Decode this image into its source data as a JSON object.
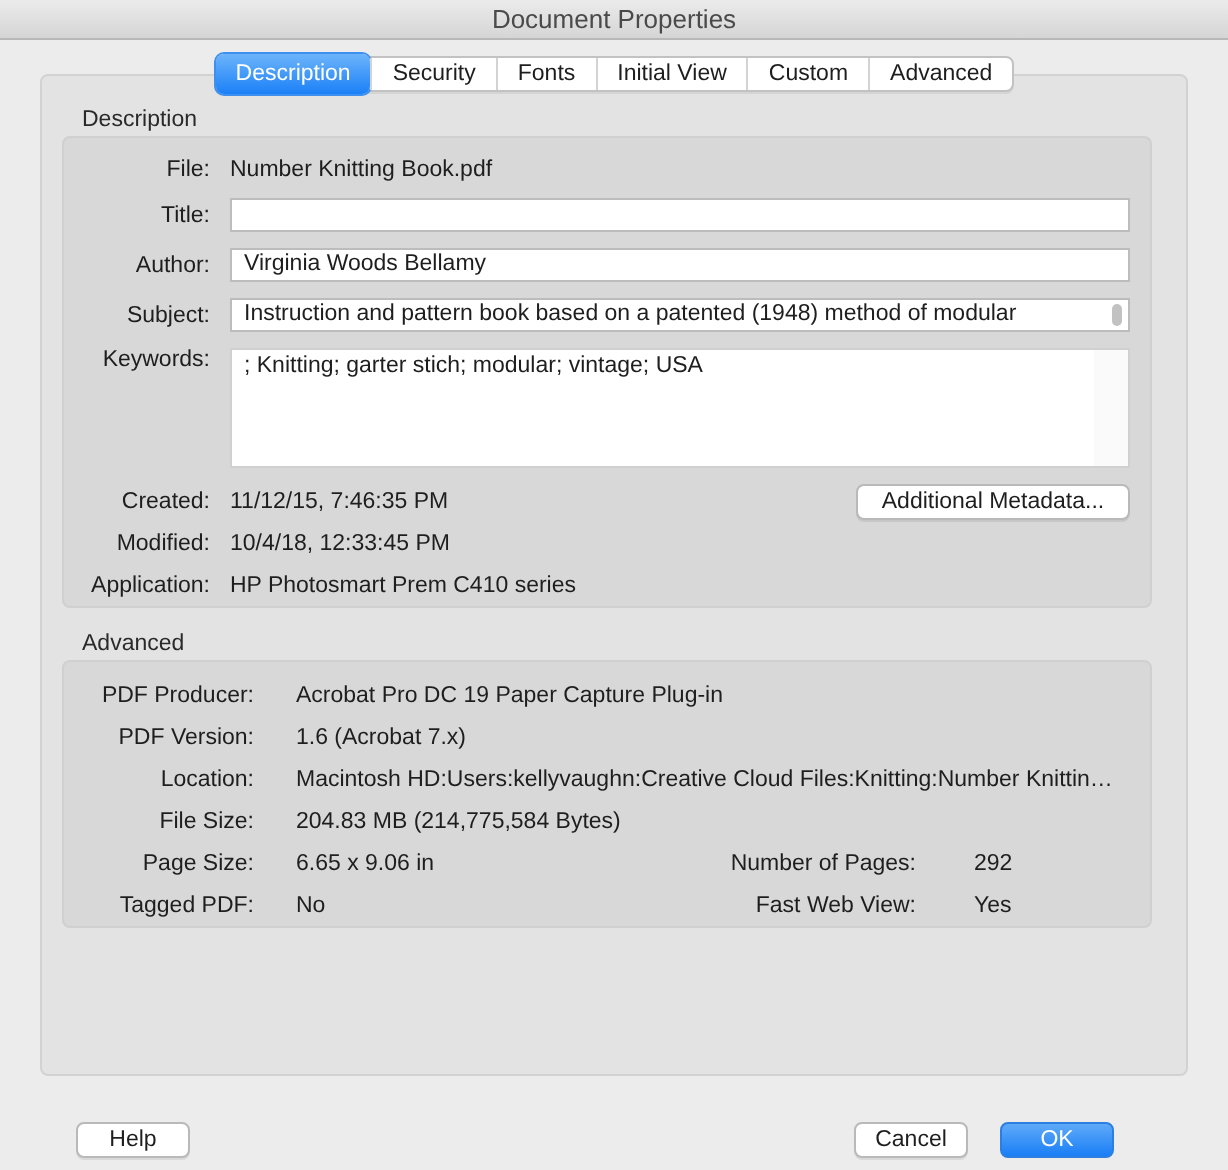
{
  "window": {
    "title": "Document Properties"
  },
  "tabs": [
    {
      "label": "Description",
      "selected": true
    },
    {
      "label": "Security",
      "selected": false
    },
    {
      "label": "Fonts",
      "selected": false
    },
    {
      "label": "Initial View",
      "selected": false
    },
    {
      "label": "Custom",
      "selected": false
    },
    {
      "label": "Advanced",
      "selected": false
    }
  ],
  "description": {
    "heading": "Description",
    "fields": [
      {
        "label": "File:",
        "kind": "text",
        "value": "Number Knitting Book.pdf"
      },
      {
        "label": "Title:",
        "kind": "input"
      },
      {
        "label": "Author:",
        "kind": "input",
        "value": "Virginia Woods Bellamy"
      },
      {
        "label": "Subject:",
        "kind": "scroll-input",
        "value": "Instruction and pattern book based on a patented (1948) method of modular"
      },
      {
        "label": "Keywords:",
        "kind": "textarea",
        "value": "; Knitting; garter stich; modular; vintage; USA"
      },
      {
        "label": "Created:",
        "kind": "text",
        "value": "11/12/15, 7:46:35 PM",
        "button": "Additional Metadata..."
      },
      {
        "label": "Modified:",
        "kind": "text",
        "value": "10/4/18, 12:33:45 PM"
      },
      {
        "label": "Application:",
        "kind": "text",
        "value": "HP Photosmart Prem C410 series"
      }
    ]
  },
  "advanced": {
    "heading": "Advanced",
    "rows": [
      {
        "label": "PDF Producer:",
        "value": "Acrobat Pro DC 19 Paper Capture Plug-in"
      },
      {
        "label": "PDF Version:",
        "value": "1.6 (Acrobat 7.x)"
      },
      {
        "label": "Location:",
        "value": "Macintosh HD:Users:kellyvaughn:Creative Cloud Files:Knitting:Number Knittin…"
      },
      {
        "label": "File Size:",
        "value": "204.83 MB (214,775,584 Bytes)"
      },
      {
        "label": "Page Size:",
        "value": "6.65 x 9.06 in",
        "extra_label": "Number of Pages:",
        "extra_value": "292"
      },
      {
        "label": "Tagged PDF:",
        "value": "No",
        "extra_label": "Fast Web View:",
        "extra_value": "Yes"
      }
    ]
  },
  "buttons": [
    {
      "label": "Help",
      "kind": "plain"
    },
    {
      "label": "Cancel",
      "kind": "plain"
    },
    {
      "label": "OK",
      "kind": "default"
    }
  ]
}
